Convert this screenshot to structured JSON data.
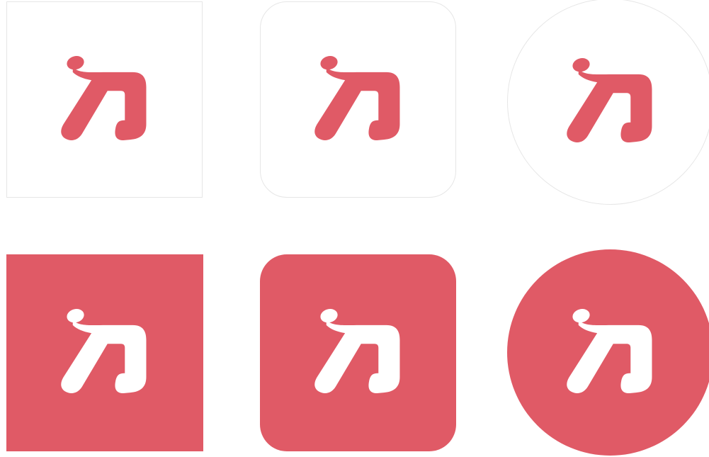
{
  "colors": {
    "brand": "#e05a66",
    "background": "#ffffff",
    "outline": "#e6e6e6",
    "mark_on_brand": "#ffffff"
  },
  "icons": [
    {
      "name": "logo-square-outline",
      "shape": "square",
      "variant": "outline"
    },
    {
      "name": "logo-rounded-outline",
      "shape": "rounded-square",
      "variant": "outline"
    },
    {
      "name": "logo-circle-outline",
      "shape": "circle",
      "variant": "outline"
    },
    {
      "name": "logo-square-filled",
      "shape": "square",
      "variant": "filled"
    },
    {
      "name": "logo-rounded-filled",
      "shape": "rounded-square",
      "variant": "filled"
    },
    {
      "name": "logo-circle-filled",
      "shape": "circle",
      "variant": "filled"
    }
  ]
}
